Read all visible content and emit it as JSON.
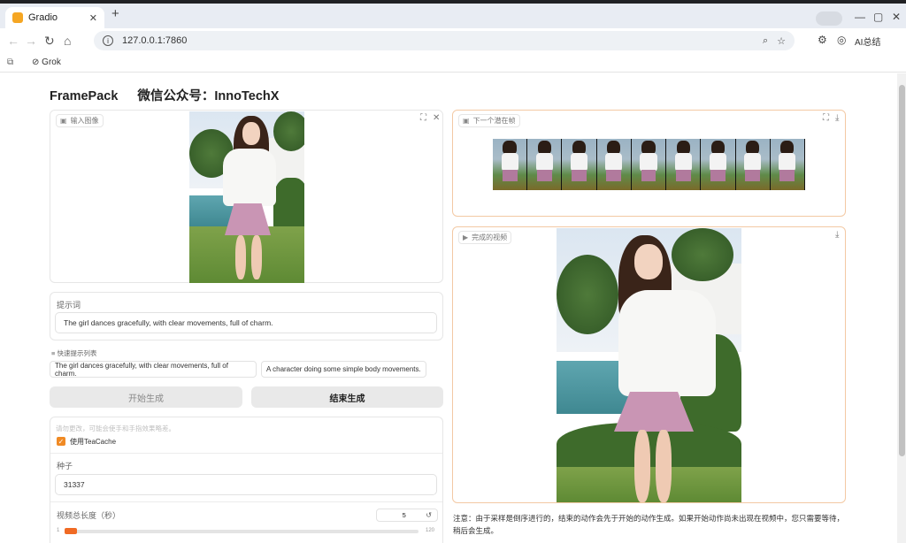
{
  "browser": {
    "tab_title": "Gradio",
    "new_tab": "+",
    "url": "127.0.0.1:7860",
    "bookmark": "Grok",
    "ai_button": "AI总结"
  },
  "app": {
    "title": "FramePack",
    "subtitle": "微信公众号：InnoTechX",
    "input_image_label": "输入图像",
    "next_frames_label": "下一个潜在帧",
    "final_video_label": "完成的视频",
    "prompt_label": "提示词",
    "prompt_value": "The girl dances gracefully, with clear movements, full of charm.",
    "quick_list_label": "快速提示列表",
    "quick_prompts": [
      "The girl dances gracefully, with clear movements, full of charm.",
      "A character doing some simple body movements."
    ],
    "start_button": "开始生成",
    "end_button": "结束生成",
    "hint_text": "请勿更改，可能会使手和手指效果略差。",
    "teacache_label": "使用TeaCache",
    "teacache_checked": true,
    "seed_label": "种子",
    "seed_value": "31337",
    "duration_label": "视频总长度（秒）",
    "duration_value": "5",
    "duration_min": "1",
    "duration_max": "120",
    "duration_fraction": 0.034,
    "note": "注意：由于采样是倒序进行的，结束的动作会先于开始的动作生成。如果开始动作尚未出现在视频中，您只需要等待，稍后会生成。"
  },
  "colors": {
    "accent": "#f08a24",
    "output_border": "#f3c9a4"
  }
}
